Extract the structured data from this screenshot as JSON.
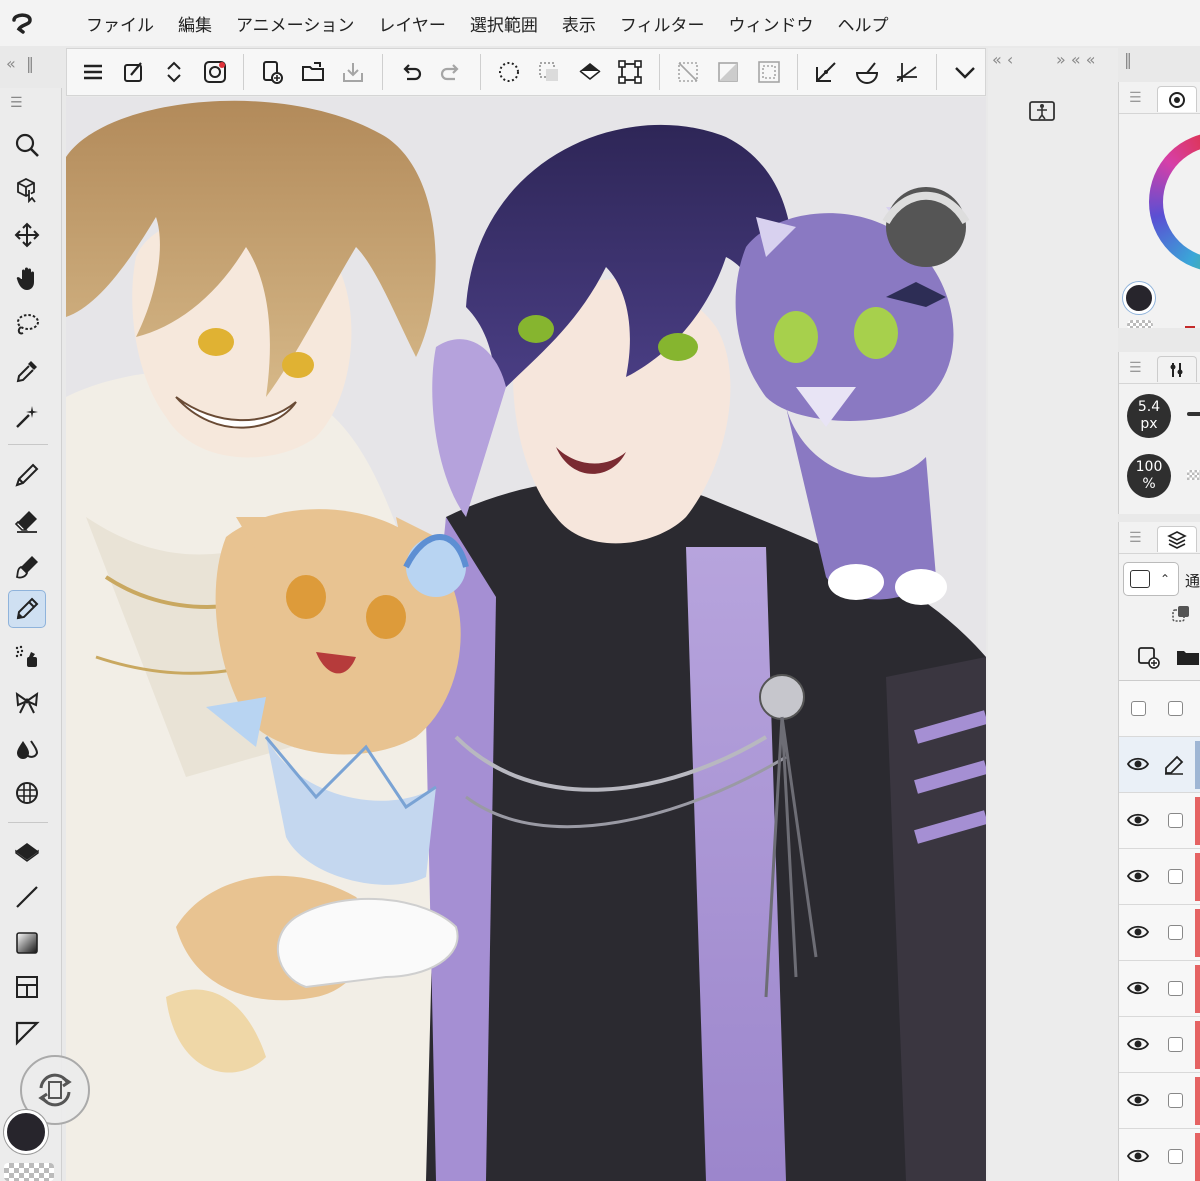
{
  "menu": {
    "items": [
      "ファイル",
      "編集",
      "アニメーション",
      "レイヤー",
      "選択範囲",
      "表示",
      "フィルター",
      "ウィンドウ",
      "ヘルプ"
    ]
  },
  "command_bar": {
    "icons": [
      "menu-icon",
      "new-canvas-icon",
      "scroll-icon",
      "cloud-icon",
      "new-file-icon",
      "open-folder-icon",
      "save-icon",
      "undo-icon",
      "redo-icon",
      "select-all-icon",
      "deselect-icon",
      "fill-icon",
      "transform-icon",
      "clear-icon",
      "clear-outside-icon",
      "show-selection-icon",
      "ruler-snap-icon",
      "special-ruler-icon",
      "grid-snap-icon",
      "more-chevron-icon"
    ]
  },
  "tool_palette": {
    "tools": [
      "zoom-icon",
      "object-icon",
      "move-icon",
      "hand-icon",
      "lasso-icon",
      "eyedropper-icon",
      "wand-icon",
      "pen-icon",
      "eraser-icon",
      "brush-icon",
      "marker-icon",
      "airbrush-icon",
      "decoration-icon",
      "blend-icon",
      "grid-icon",
      "fill-icon",
      "line-icon",
      "gradient-icon",
      "frame-icon",
      "text-triangle-icon"
    ],
    "selected_tool": "marker-icon",
    "main_color": "#27252c"
  },
  "brush_size": {
    "value": "5.4",
    "unit": "px"
  },
  "brush_opacity": {
    "value": "100",
    "unit": "%"
  },
  "layers": {
    "partial_label": "通",
    "rows": [
      {
        "visible": false,
        "checked": false,
        "thumb": false
      },
      {
        "visible": true,
        "checked": false,
        "thumb": false,
        "editing": true
      },
      {
        "visible": true,
        "checked": false,
        "thumb": true
      },
      {
        "visible": true,
        "checked": false,
        "thumb": true
      },
      {
        "visible": true,
        "checked": false,
        "thumb": true
      },
      {
        "visible": true,
        "checked": false,
        "thumb": true
      },
      {
        "visible": true,
        "checked": false,
        "thumb": true
      },
      {
        "visible": true,
        "checked": false,
        "thumb": true
      },
      {
        "visible": true,
        "checked": false,
        "thumb": true
      }
    ]
  },
  "colors": {
    "accent": "#8fb3db",
    "panel_bg": "#f2f2f2",
    "layer_thumb": "#e56363",
    "color_wheel_ring": "#d63fa8"
  }
}
